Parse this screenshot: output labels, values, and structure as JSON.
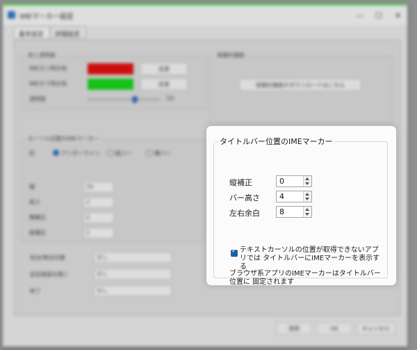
{
  "window": {
    "title": "IMEマーカー設定",
    "controls": [
      "—",
      "☐",
      "✕"
    ]
  },
  "tabs": [
    "基本設定",
    "詳細設定"
  ],
  "background": {
    "display_group": {
      "label": "色と透明度",
      "rows": [
        {
          "label": "IMEオン時の色",
          "color": "#e01010",
          "button": "変更"
        },
        {
          "label": "IMEオフ時の色",
          "color": "#19d219",
          "button": "変更"
        }
      ],
      "opacity_label": "透明度",
      "opacity_value": "50"
    },
    "extra_group": {
      "label": "実験的機能",
      "button": "実験的機能のダウンロードはこちら"
    },
    "cursor_group": {
      "label": "カーソル位置のIMEマーカー",
      "shape_label": "形",
      "radios": [
        "アンダーライン",
        "縦バー",
        "横バー"
      ],
      "fields": [
        {
          "label": "幅",
          "value": "20"
        },
        {
          "label": "高さ",
          "value": "2"
        },
        {
          "label": "横補正",
          "value": "0"
        },
        {
          "label": "縦補正",
          "value": "2"
        }
      ]
    },
    "hotkeys": [
      {
        "label": "有効/無効切替",
        "value": "なし"
      },
      {
        "label": "設定画面を開く",
        "value": "なし"
      },
      {
        "label": "終了",
        "value": "なし"
      }
    ],
    "footer_buttons": [
      "適用",
      "OK",
      "キャンセル"
    ]
  },
  "card": {
    "legend": "タイトルバー位置のIMEマーカー",
    "fields": [
      {
        "label": "縦補正",
        "value": "0"
      },
      {
        "label": "バー高さ",
        "value": "4"
      },
      {
        "label": "左右余白",
        "value": "8"
      }
    ],
    "checkbox_label": "テキストカーソルの位置が取得できないアプリでは タイトルバーにIMEマーカーを表示する",
    "checkbox_checked": true,
    "note": "ブラウザ系アプリのIMEマーカーはタイトルバー位置に 固定されます"
  }
}
